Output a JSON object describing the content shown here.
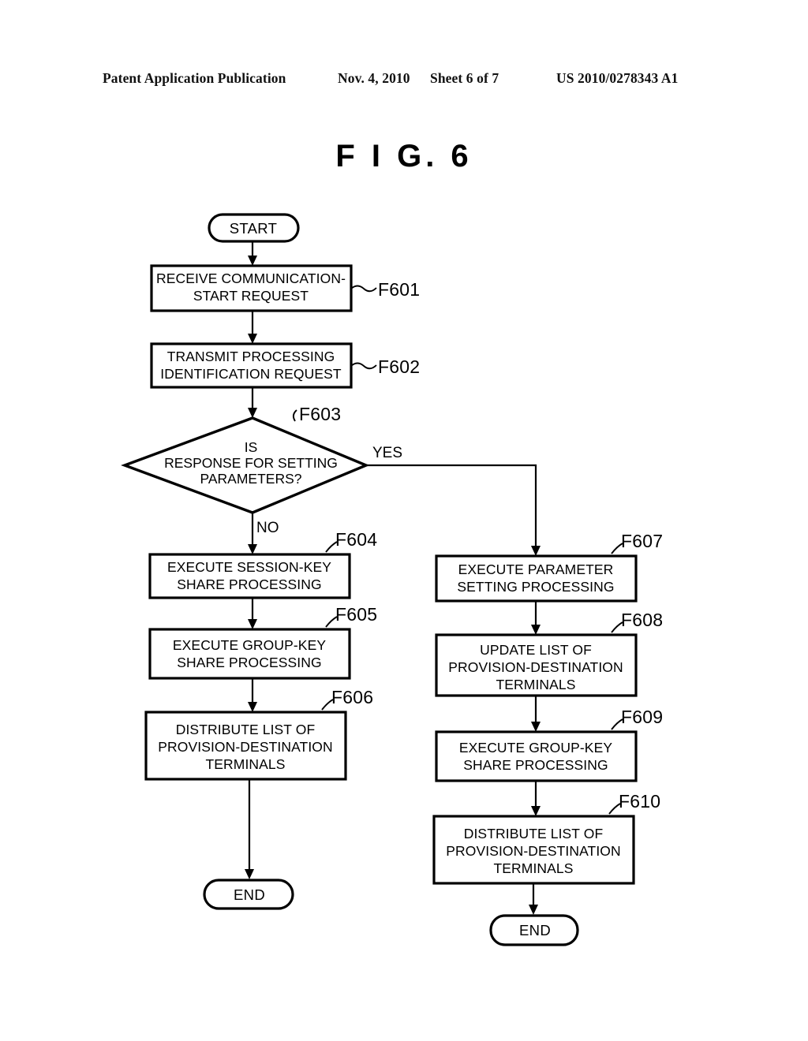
{
  "header": {
    "publication": "Patent Application Publication",
    "date": "Nov. 4, 2010",
    "sheet": "Sheet 6 of 7",
    "number": "US 2010/0278343 A1"
  },
  "figure": {
    "title": "F I G.  6"
  },
  "flowchart": {
    "start_label": "START",
    "end_label_left": "END",
    "end_label_right": "END",
    "branch_yes": "YES",
    "branch_no": "NO",
    "decision": {
      "step": "F603",
      "line1": "IS",
      "line2": "RESPONSE FOR SETTING",
      "line3": "PARAMETERS?"
    },
    "steps": [
      {
        "step": "F601",
        "line1": "RECEIVE COMMUNICATION-",
        "line2": "START REQUEST",
        "line3": ""
      },
      {
        "step": "F602",
        "line1": "TRANSMIT PROCESSING",
        "line2": "IDENTIFICATION REQUEST",
        "line3": ""
      },
      {
        "step": "F604",
        "line1": "EXECUTE SESSION-KEY",
        "line2": "SHARE PROCESSING",
        "line3": ""
      },
      {
        "step": "F605",
        "line1": "EXECUTE GROUP-KEY",
        "line2": "SHARE PROCESSING",
        "line3": ""
      },
      {
        "step": "F606",
        "line1": "DISTRIBUTE LIST OF",
        "line2": "PROVISION-DESTINATION",
        "line3": "TERMINALS"
      },
      {
        "step": "F607",
        "line1": "EXECUTE PARAMETER",
        "line2": "SETTING PROCESSING",
        "line3": ""
      },
      {
        "step": "F608",
        "line1": "UPDATE LIST OF",
        "line2": "PROVISION-DESTINATION",
        "line3": "TERMINALS"
      },
      {
        "step": "F609",
        "line1": "EXECUTE GROUP-KEY",
        "line2": "SHARE PROCESSING",
        "line3": ""
      },
      {
        "step": "F610",
        "line1": "DISTRIBUTE LIST OF",
        "line2": "PROVISION-DESTINATION",
        "line3": "TERMINALS"
      }
    ]
  }
}
